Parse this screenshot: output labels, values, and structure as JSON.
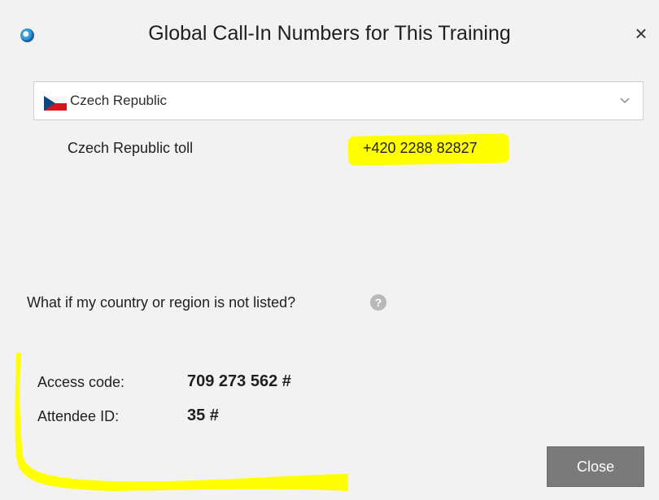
{
  "window": {
    "title": "Global Call-In Numbers for This Training",
    "close_symbol": "×"
  },
  "country_selector": {
    "selected": "Czech Republic",
    "flag_icon": "czech-flag-icon"
  },
  "call_in": {
    "label": "Czech Republic toll",
    "number": "+420 2288 82827"
  },
  "help": {
    "question": "What if my country or region is not listed?",
    "icon": "question-icon"
  },
  "meeting_info": {
    "access_code_label": "Access code:",
    "access_code_value": "709 273 562 #",
    "attendee_id_label": "Attendee ID:",
    "attendee_id_value": "35 #"
  },
  "buttons": {
    "close": "Close"
  },
  "colors": {
    "highlight": "#ffff00",
    "button": "#7a7a7a"
  }
}
